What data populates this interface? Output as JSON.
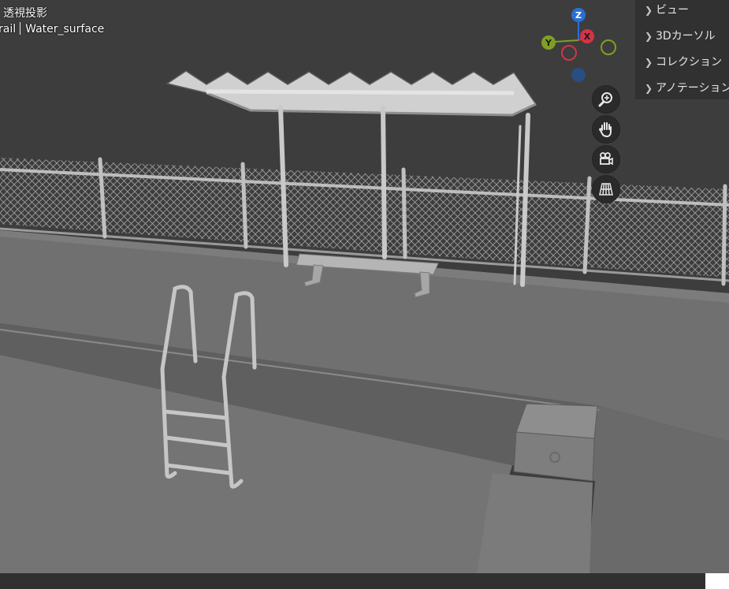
{
  "viewport": {
    "view_mode": "透視投影",
    "breadcrumb": [
      "rail",
      "Water_surface"
    ]
  },
  "gizmo": {
    "axis_z": "Z",
    "axis_x": "X",
    "axis_y": "Y",
    "colors": {
      "z": "#2b6fd6",
      "x": "#d23447",
      "y": "#7ea022",
      "neg_z": "#284e82",
      "neg_x": "#8a2634",
      "neg_y": "#51661b"
    }
  },
  "nav_tools": [
    "zoom-icon",
    "hand-icon",
    "camera-icon",
    "grid-icon"
  ],
  "sidebar": {
    "items": [
      {
        "label": "ビュー",
        "chevron": "chevron-right-icon"
      },
      {
        "label": "3Dカーソル",
        "chevron": "chevron-right-icon"
      },
      {
        "label": "コレクション",
        "chevron": "chevron-right-icon"
      },
      {
        "label": "アノテーション",
        "chevron": "chevron-right-icon"
      }
    ]
  }
}
